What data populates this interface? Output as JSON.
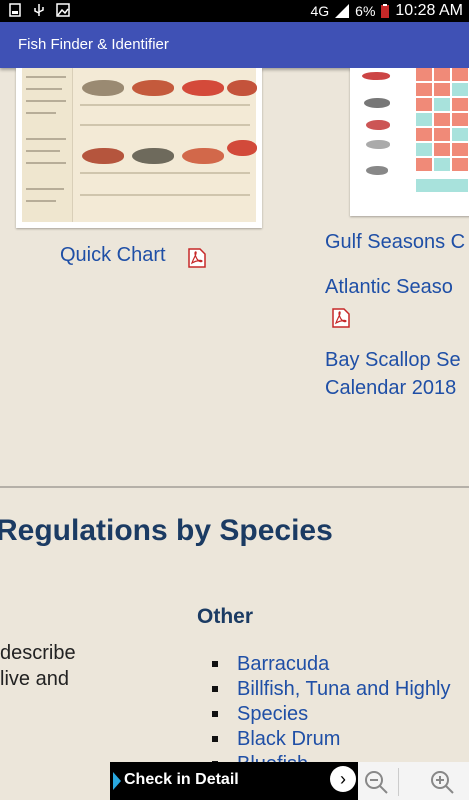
{
  "status_bar": {
    "left_icons": [
      "gallery-icon",
      "usb-icon",
      "image-icon"
    ],
    "network": "4G",
    "battery": "6%",
    "time": "10:28 AM"
  },
  "app_bar": {
    "title": "Fish Finder & Identifier"
  },
  "quick_chart": {
    "label": "Quick Chart"
  },
  "season_links": [
    {
      "label": "Gulf Seasons C"
    },
    {
      "label": "Atlantic Seaso"
    },
    {
      "label": "Bay Scallop Se"
    },
    {
      "label": "Calendar 2018"
    }
  ],
  "section": {
    "heading": "Regulations by Species",
    "intro_line1": "describe",
    "intro_line2": "live and",
    "other_heading": "Other",
    "other_items": [
      "Barracuda",
      "Billfish, Tuna and Highly",
      "Species",
      "Black Drum",
      "Bluefish"
    ]
  },
  "ad": {
    "label": "Check in Detail"
  },
  "colors": {
    "appbar": "#3f51b5",
    "link": "#1f4fa6",
    "heading": "#1b3b63",
    "background": "#ece6da"
  }
}
